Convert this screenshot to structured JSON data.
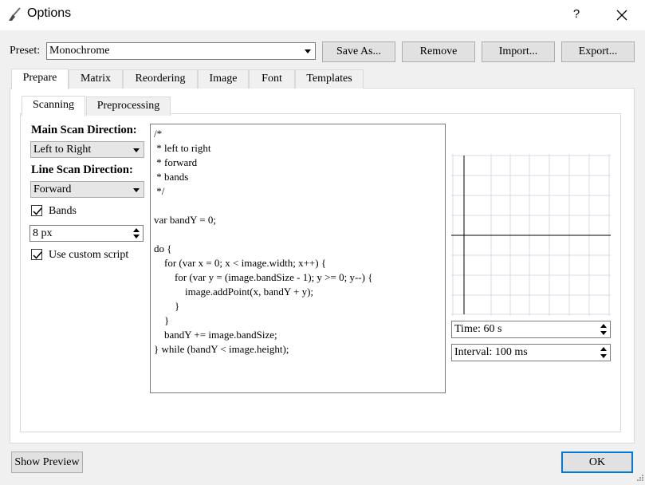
{
  "window": {
    "title": "Options",
    "help_label": "?",
    "close_icon": "close-icon",
    "app_icon": "brush-icon"
  },
  "preset": {
    "label": "Preset:",
    "value": "Monochrome",
    "buttons": {
      "save_as": "Save As...",
      "remove": "Remove",
      "import": "Import...",
      "export": "Export..."
    }
  },
  "tabs": [
    "Prepare",
    "Matrix",
    "Reordering",
    "Image",
    "Font",
    "Templates"
  ],
  "subtabs": [
    "Scanning",
    "Preprocessing"
  ],
  "scanning": {
    "main_dir_label": "Main Scan Direction:",
    "main_dir_value": "Left to Right",
    "line_dir_label": "Line Scan Direction:",
    "line_dir_value": "Forward",
    "bands_label": "Bands",
    "bands_checked": true,
    "band_size": "8 px",
    "custom_script_label": "Use custom script",
    "custom_script_checked": true,
    "script_lines": [
      "/*",
      " * left to right",
      " * forward",
      " * bands",
      " */",
      "",
      "var bandY = 0;",
      "",
      "do {",
      "    for (var x = 0; x < image.width; x++) {",
      "        for (var y = (image.bandSize - 1); y >= 0; y--) {",
      "            image.addPoint(x, bandY + y);",
      "        }",
      "    }",
      "    bandY += image.bandSize;",
      "} while (bandY < image.height);"
    ],
    "time": "Time: 60 s",
    "interval": "Interval: 100 ms"
  },
  "footer": {
    "show_preview": "Show Preview",
    "ok": "OK"
  },
  "colors": {
    "ok_border": "#0078d7",
    "panel_border": "#d9d9d9",
    "grid_line": "#d9d9e6"
  }
}
